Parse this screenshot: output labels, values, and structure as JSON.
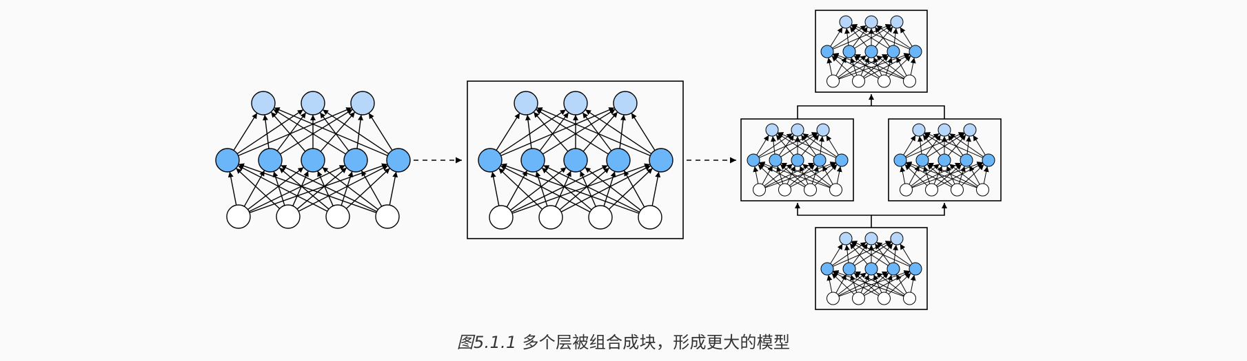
{
  "caption": {
    "number": "图5.1.1",
    "text": "多个层被组合成块，形成更大的模型"
  },
  "colors": {
    "background": "#fafafa",
    "input_node": "#ffffff",
    "hidden_node": "#6ab6f8",
    "output_node": "#b6d6fa",
    "stroke": "#000000"
  },
  "diagram": {
    "stages": [
      "single-network",
      "network-in-block",
      "blocks-composed"
    ],
    "layers": [
      "input",
      "hidden",
      "output"
    ],
    "layer_node_counts": [
      4,
      5,
      3
    ],
    "composition": {
      "bottom_blocks": 1,
      "middle_blocks": 2,
      "top_blocks": 1
    }
  }
}
